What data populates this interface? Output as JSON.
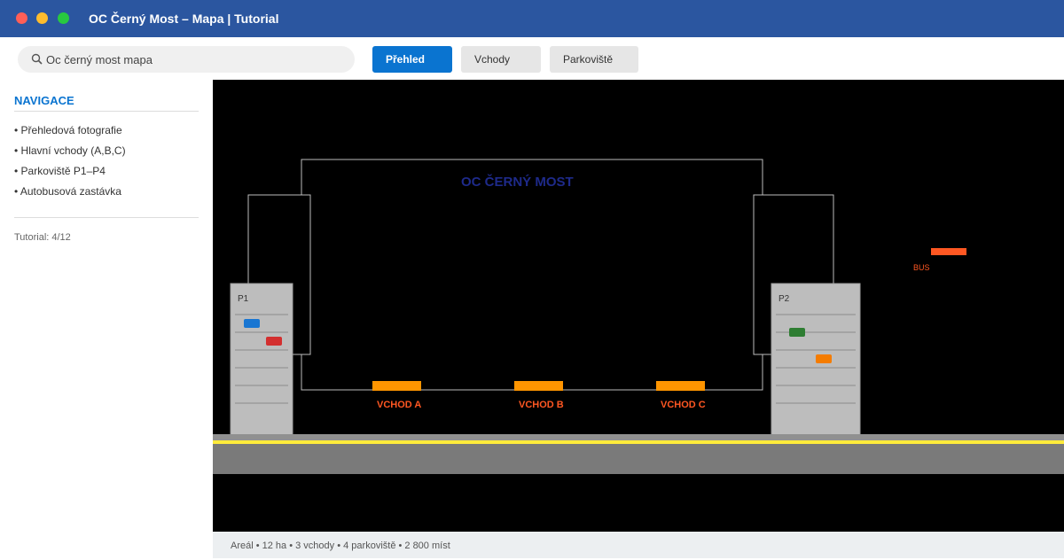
{
  "window": {
    "title": "OC Černý Most – Mapa | Tutorial"
  },
  "search": {
    "value": "Oc černý most mapa"
  },
  "tabs": [
    {
      "label": "Přehled",
      "active": true
    },
    {
      "label": "Vchody",
      "active": false
    },
    {
      "label": "Parkoviště",
      "active": false
    }
  ],
  "sidebar": {
    "heading": "NAVIGACE",
    "items": [
      {
        "label": "• Přehledová fotografie"
      },
      {
        "label": "• Hlavní vchody (A,B,C)"
      },
      {
        "label": "• Parkoviště P1–P4"
      },
      {
        "label": "• Autobusová zastávka"
      }
    ],
    "progress": "Tutorial: 4/12"
  },
  "map": {
    "building_label": "OC ČERNÝ MOST",
    "entrances": [
      {
        "label": "VCHOD A"
      },
      {
        "label": "VCHOD B"
      },
      {
        "label": "VCHOD C"
      }
    ],
    "parking": [
      {
        "label": "P1"
      },
      {
        "label": "P2"
      }
    ],
    "bus_label": "BUS"
  },
  "status": {
    "text": "Areál • 12 ha • 3 vchody • 4 parkoviště • 2 800 míst"
  },
  "colors": {
    "titlebar": "#2b56a0",
    "accent": "#0a74d0",
    "entrance": "#ff9500",
    "entrance_label": "#ff5722",
    "building_label": "#1e2a8a",
    "road_stripe": "#ffeb3b",
    "car_blue": "#1976d2",
    "car_red": "#d32f2f",
    "car_green": "#2e7d32",
    "car_orange": "#f57c00"
  }
}
